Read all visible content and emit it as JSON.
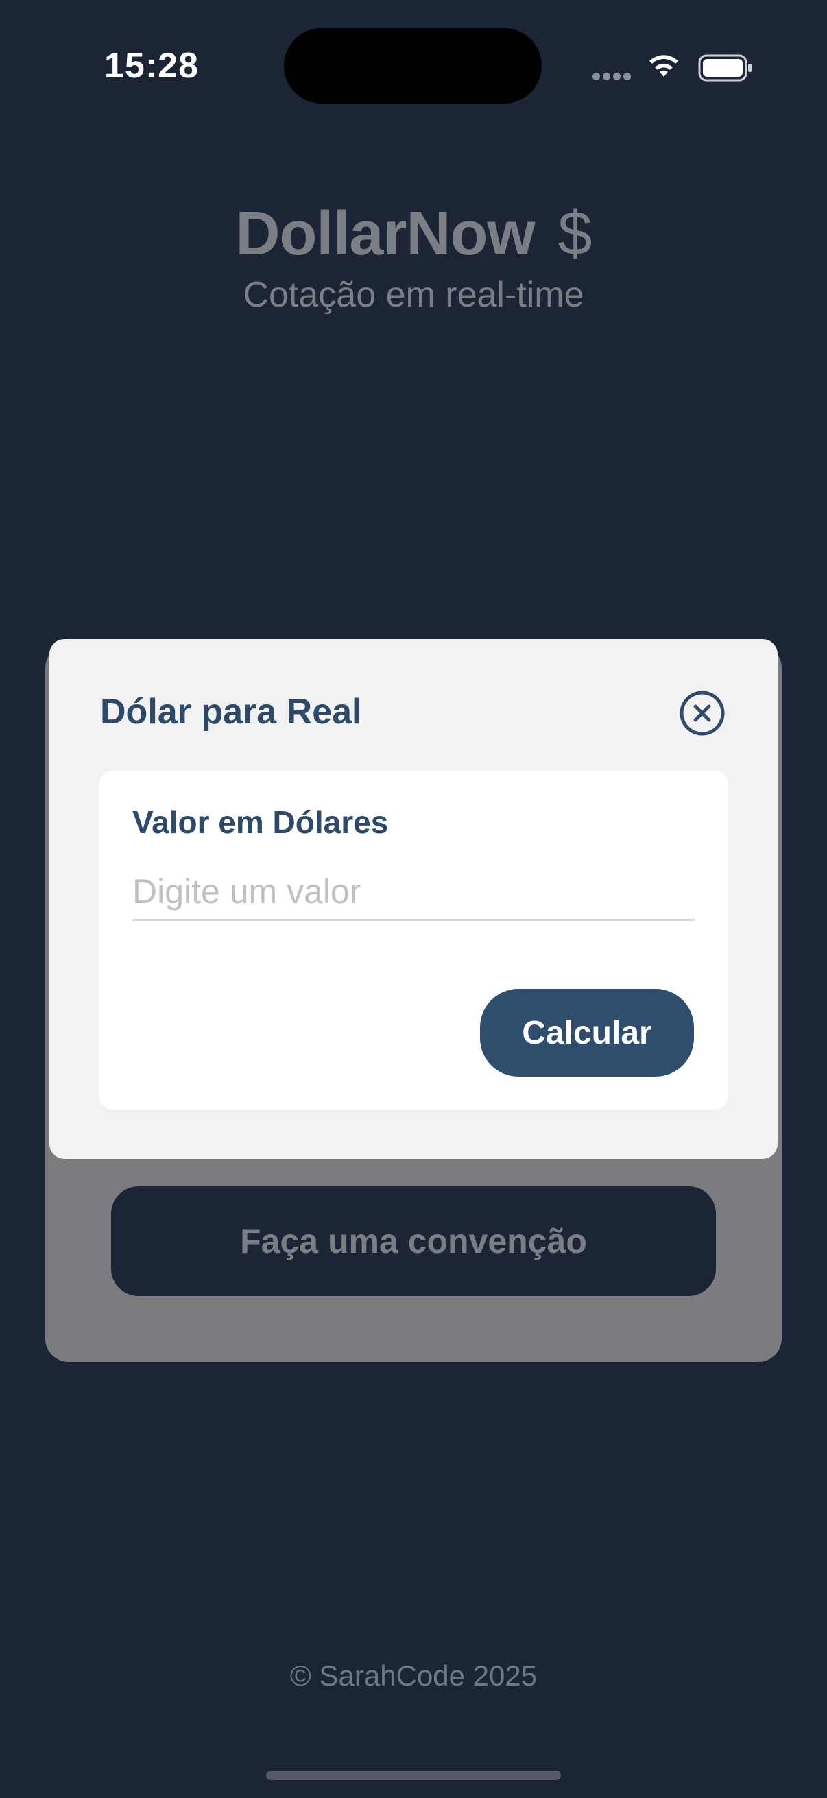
{
  "status_bar": {
    "time": "15:28"
  },
  "header": {
    "title": "DollarNow",
    "title_symbol": "$",
    "subtitle": "Cotação em real-time"
  },
  "background_card": {
    "button_label": "Faça uma convenção"
  },
  "modal": {
    "title": "Dólar para Real",
    "field_label": "Valor em Dólares",
    "input_placeholder": "Digite um valor",
    "input_value": "",
    "calculate_label": "Calcular"
  },
  "footer": {
    "text": "© SarahCode 2025"
  },
  "colors": {
    "background": "#1b2535",
    "accent": "#2f4e6e",
    "modal_title": "#2f4a68"
  }
}
